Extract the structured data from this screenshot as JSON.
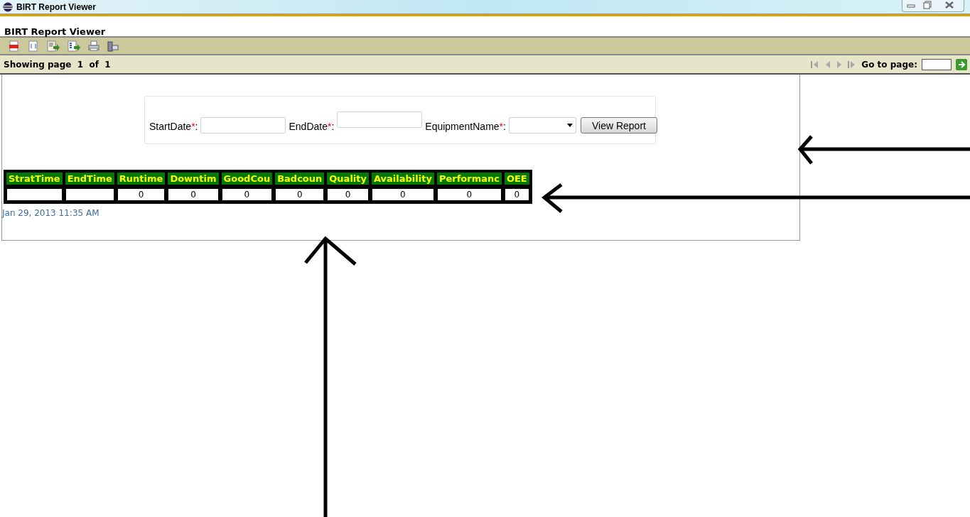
{
  "window": {
    "title": "BIRT Report Viewer"
  },
  "app_title": "BIRT Report Viewer",
  "status": {
    "text": "Showing page  1  of  1",
    "goto_label": "Go to page:"
  },
  "parameters": [
    {
      "label": "StartDate",
      "required_mark": "*",
      "separator": ":",
      "kind": "text"
    },
    {
      "label": "EndDate",
      "required_mark": "*",
      "separator": ":",
      "kind": "text_raised"
    },
    {
      "label": "EquipmentName",
      "required_mark": "*",
      "separator": ":",
      "kind": "select"
    }
  ],
  "view_button": "View Report",
  "table": {
    "columns": [
      "StratTime",
      "EndTime",
      "Runtime",
      "Downtim",
      "GoodCou",
      "Badcoun",
      "Quality",
      "Availability",
      "Performanc",
      "OEE"
    ],
    "rows": [
      [
        null,
        null,
        "0",
        "0",
        "0",
        "0",
        "0",
        "0",
        "0",
        "0"
      ]
    ]
  },
  "timestamp": "Jan 29, 2013 11:35 AM"
}
